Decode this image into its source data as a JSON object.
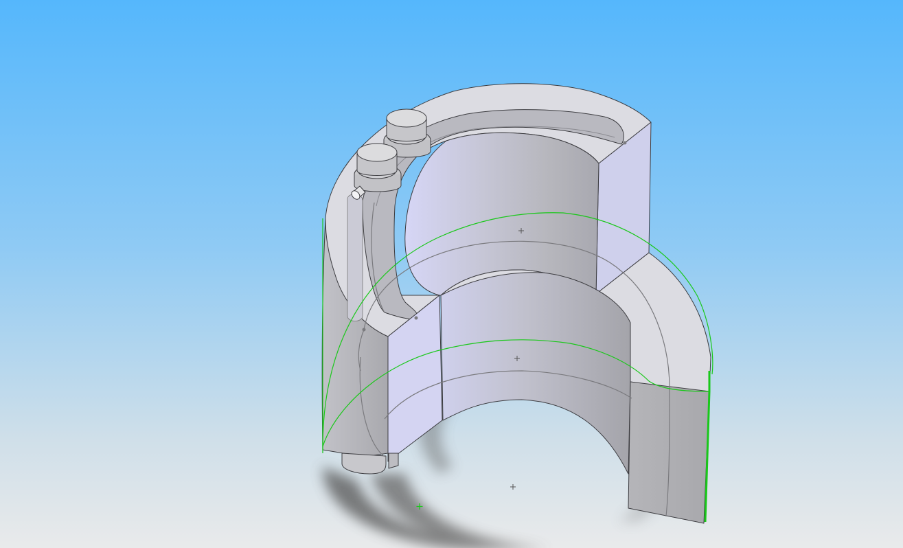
{
  "viewport": {
    "kind": "cad-3d-model-view",
    "background_top": "#55b7fc",
    "background_bottom": "#e6e8ea"
  },
  "model": {
    "face_light": "#dcdce2",
    "face_mid": "#c4c4ca",
    "face_dark": "#a8a8ae",
    "face_lavender": "#d8d8f4",
    "edge_color": "#3c3c40",
    "silhouette_edge_color": "#7a7a7e",
    "selected_edge_color": "#19c819",
    "shadow_color": "#5a5a5c"
  },
  "markers": {
    "origin_color": "#555555",
    "selection_point_color": "#19c819"
  }
}
